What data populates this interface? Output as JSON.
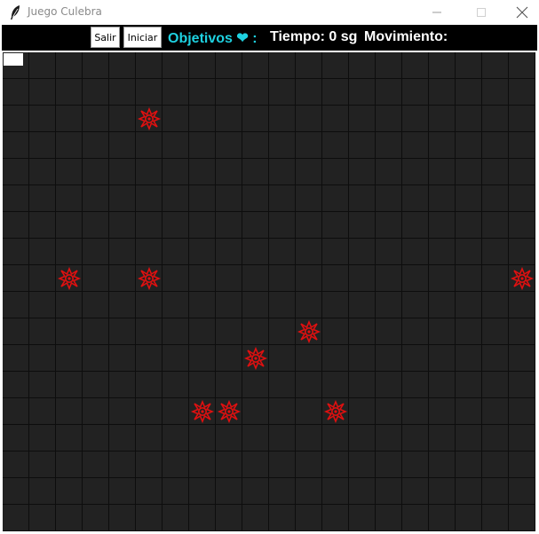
{
  "window": {
    "title": "Juego Culebra",
    "icon": "feather-icon",
    "controls": [
      "minimize-icon",
      "maximize-icon",
      "close-icon"
    ]
  },
  "toolbar": {
    "salir_label": "Salir",
    "iniciar_label": "Iniciar",
    "objetivos_label": "Objetivos ❤ :",
    "tiempo_label": "Tiempo: 0 sg",
    "movimiento_label": "Movimiento:"
  },
  "colors": {
    "toolbar_bg": "#000000",
    "objetivos": "#1ed1e0",
    "info_text": "#ffffff",
    "board_bg": "#222222",
    "grid_line": "#0d0d0d",
    "target": "#e01010",
    "snake": "#ffffff"
  },
  "board": {
    "columns": 20,
    "rows": 18,
    "snake": [
      {
        "col": 0,
        "row": 0
      }
    ],
    "targets": [
      {
        "col": 5,
        "row": 2
      },
      {
        "col": 2,
        "row": 8
      },
      {
        "col": 5,
        "row": 8
      },
      {
        "col": 19,
        "row": 8
      },
      {
        "col": 11,
        "row": 10
      },
      {
        "col": 9,
        "row": 11
      },
      {
        "col": 7,
        "row": 13
      },
      {
        "col": 8,
        "row": 13
      },
      {
        "col": 12,
        "row": 13
      }
    ]
  }
}
